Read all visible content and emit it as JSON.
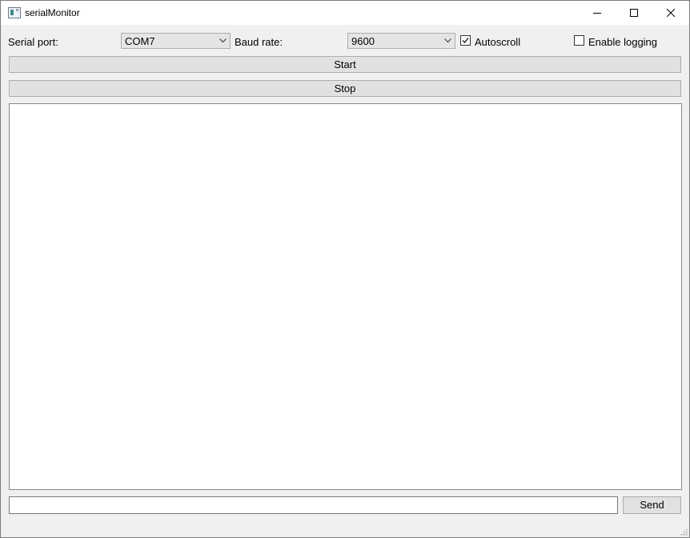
{
  "window": {
    "title": "serialMonitor",
    "icon": "app-window-icon",
    "controls": [
      "minimize-icon",
      "maximize-icon",
      "close-icon"
    ]
  },
  "toolbar": {
    "serial_port_label": "Serial port:",
    "serial_port_value": "COM7",
    "baud_rate_label": "Baud rate:",
    "baud_rate_value": "9600",
    "autoscroll_label": "Autoscroll",
    "autoscroll_checked": true,
    "logging_label": "Enable logging",
    "logging_checked": false
  },
  "buttons": {
    "start_label": "Start",
    "stop_label": "Stop",
    "send_label": "Send"
  },
  "output": {
    "text": ""
  },
  "send": {
    "value": "",
    "placeholder": ""
  },
  "colors": {
    "window_bg": "#f0f0f0",
    "titlebar_bg": "#ffffff",
    "button_bg": "#e1e1e1",
    "combo_bg": "#e5e5e5",
    "border": "#adadad"
  }
}
